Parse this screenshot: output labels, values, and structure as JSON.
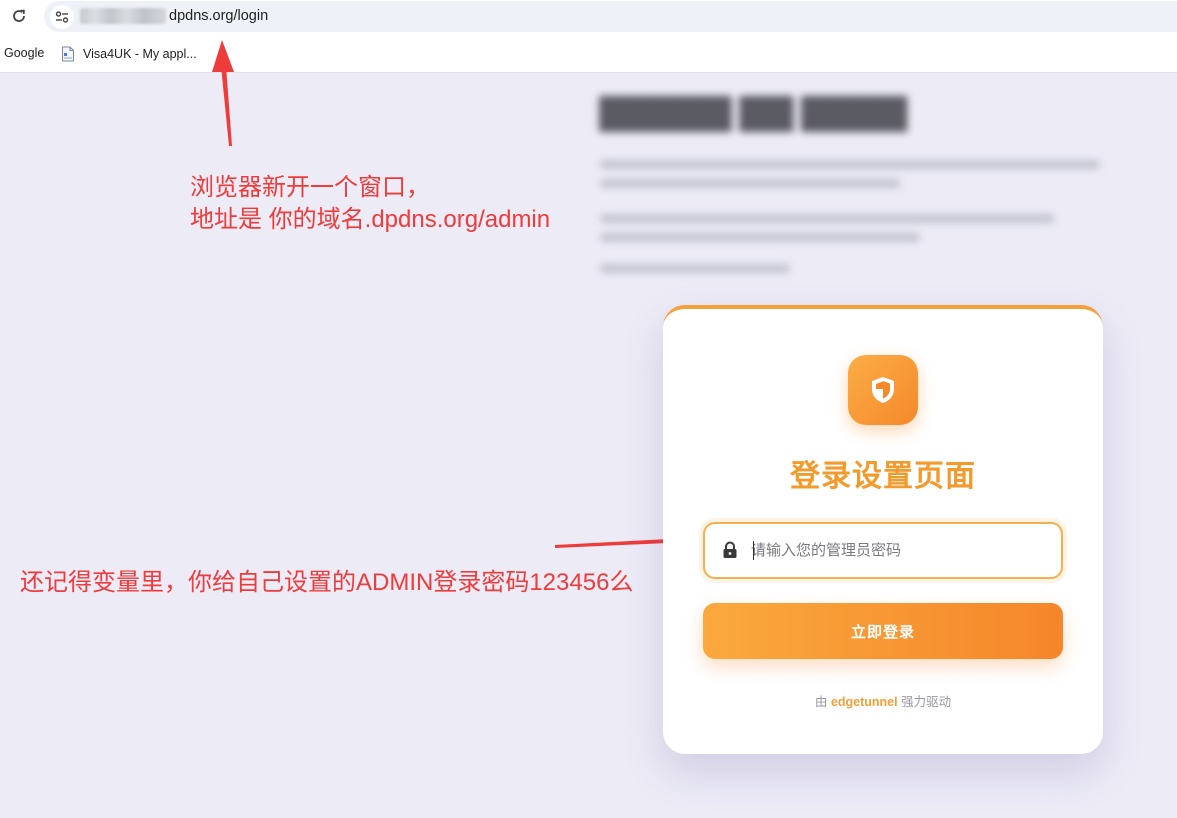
{
  "browser": {
    "url_visible": "dpdns.org/login",
    "reload_icon": "reload-icon",
    "site_info_icon": "tune-icon",
    "bookmarks": [
      {
        "label": "Google"
      },
      {
        "label": "Visa4UK - My appl...",
        "icon": "document-icon"
      }
    ]
  },
  "annotations": {
    "note_1_line_1": "浏览器新开一个窗口，",
    "note_1_line_2": "地址是  你的域名.dpdns.org/admin",
    "note_2": "还记得变量里，你给自己设置的ADMIN登录密码123456么",
    "color": "#ee3b3b"
  },
  "login": {
    "logo_icon": "shield-icon",
    "title": "登录设置页面",
    "password_placeholder": "请输入您的管理员密码",
    "password_value": "",
    "lock_icon": "lock-icon",
    "submit_label": "立即登录",
    "footer_prefix": "由",
    "footer_brand": "edgetunnel",
    "footer_suffix": "强力驱动",
    "accent_color": "#f5892a"
  }
}
